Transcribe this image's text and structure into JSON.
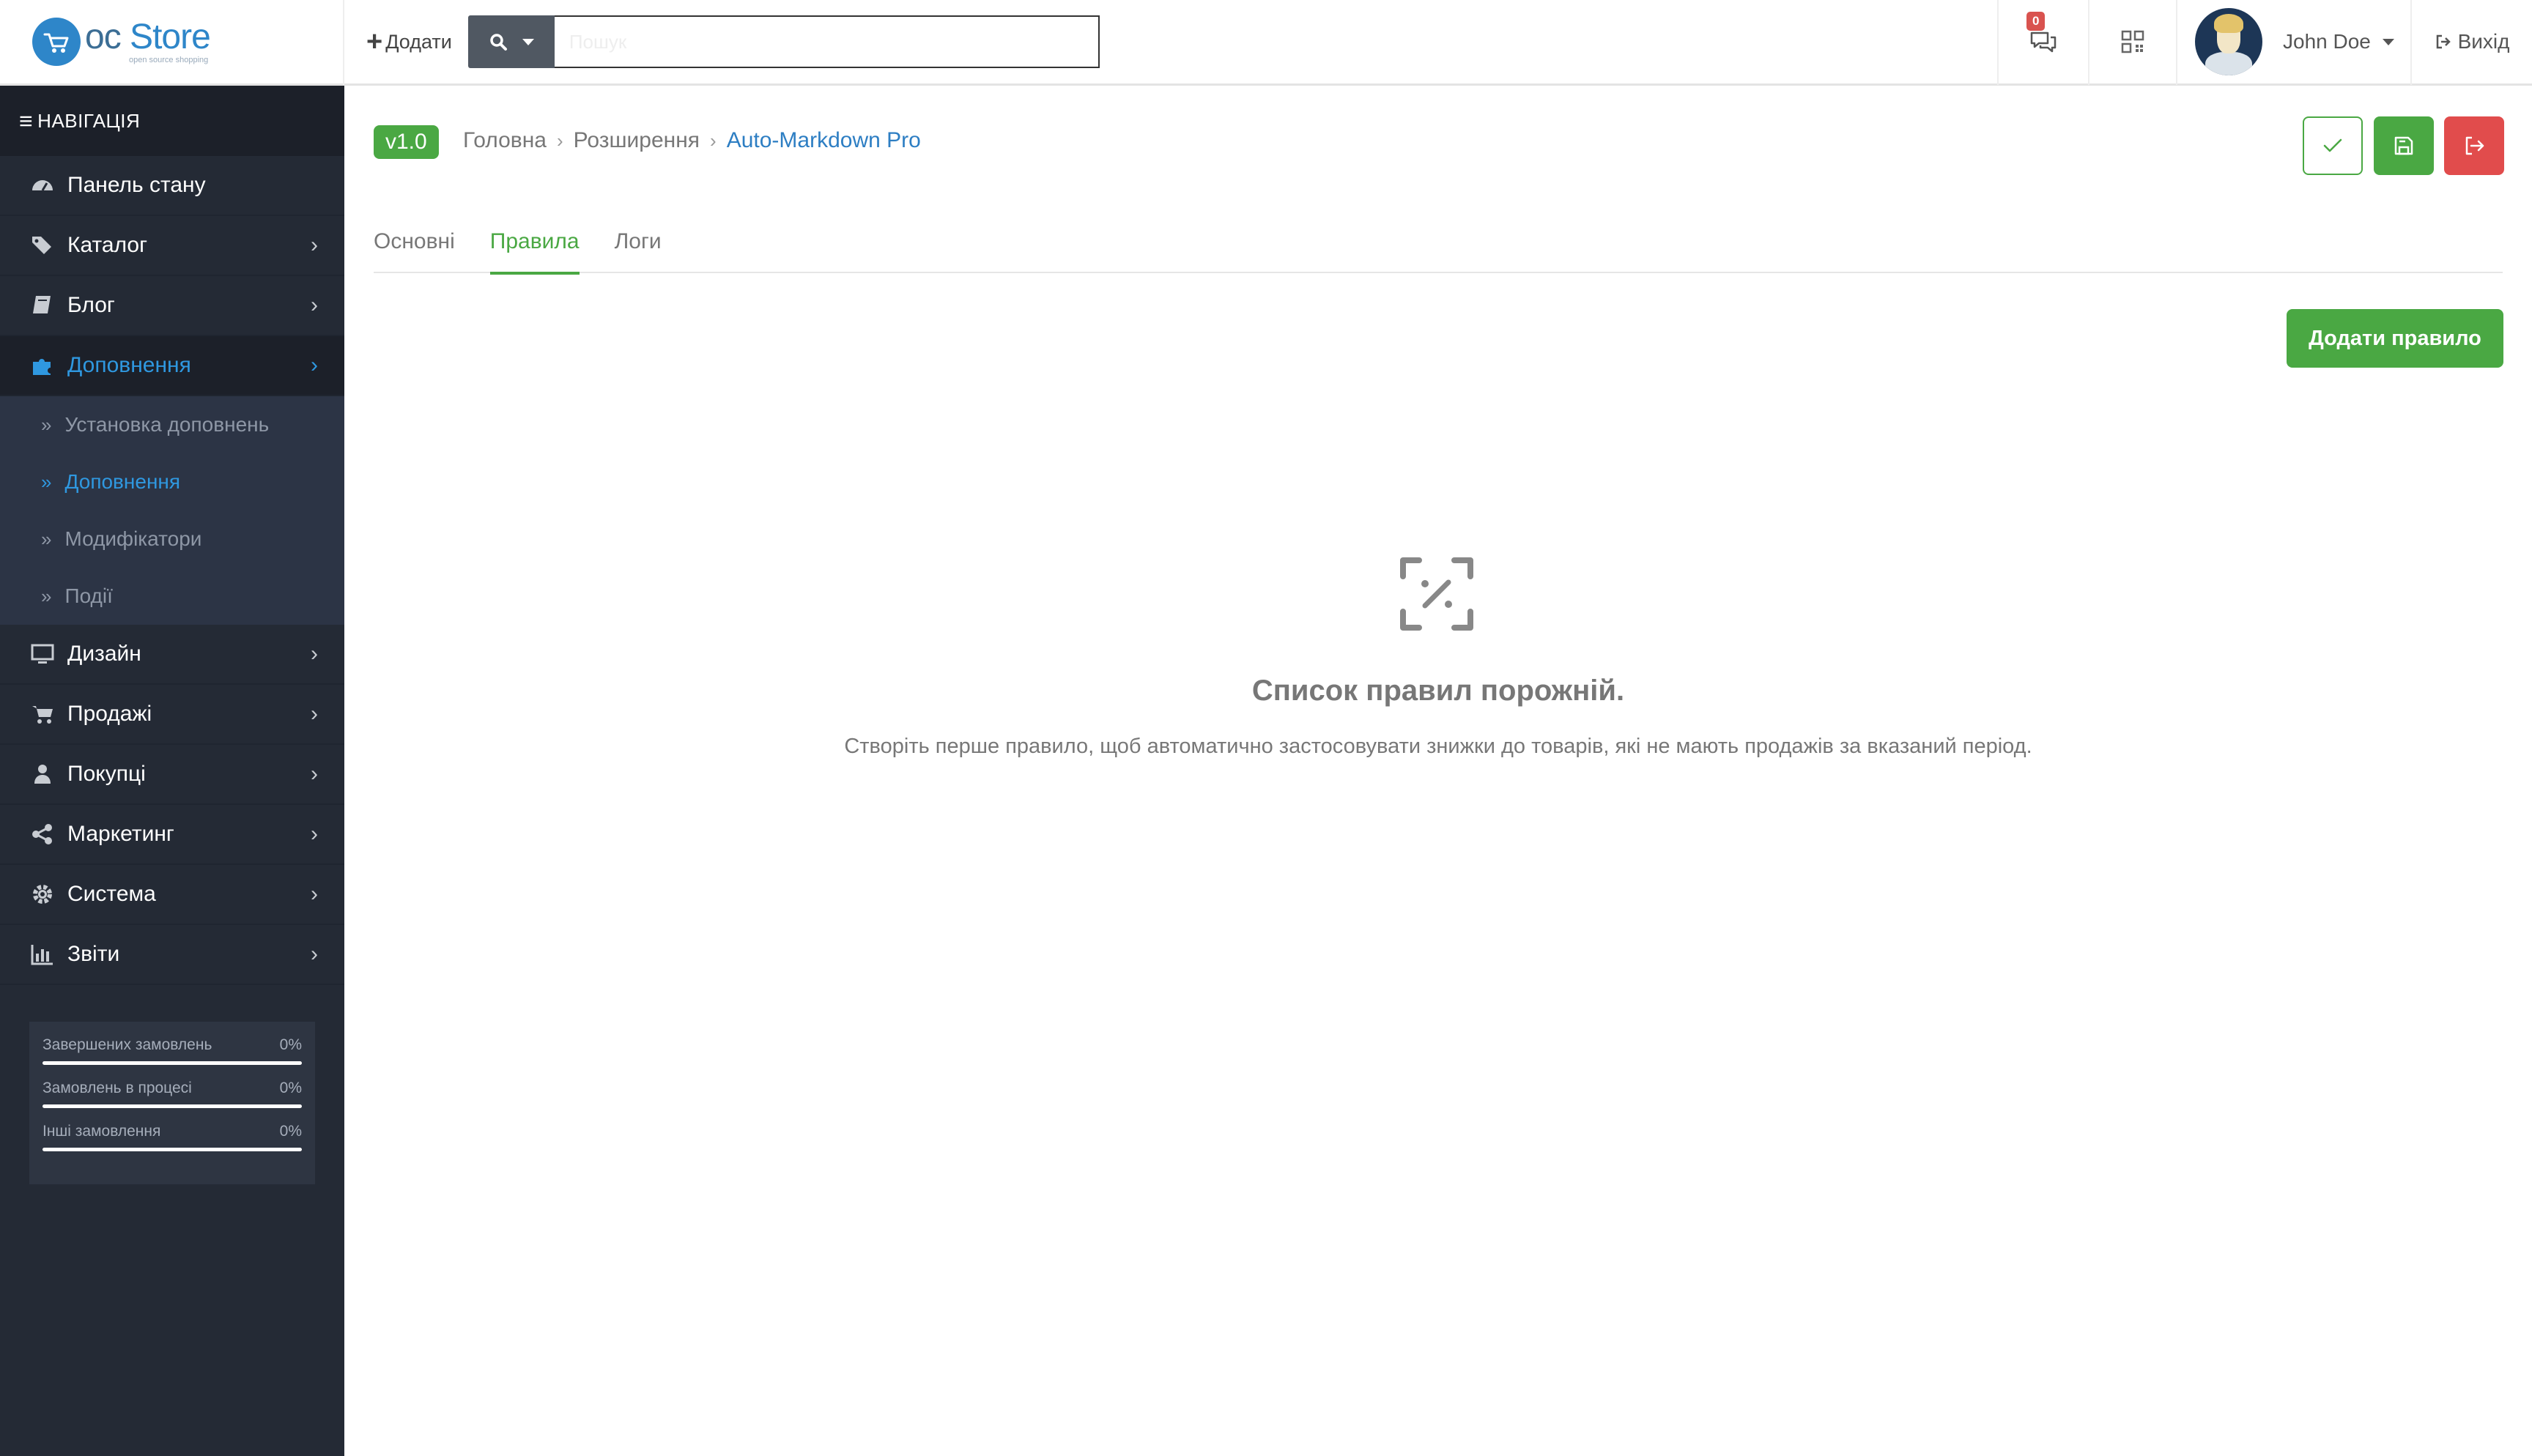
{
  "header": {
    "logo_prefix": "oc",
    "logo_brand": "Store",
    "logo_tagline": "open source shopping",
    "add_label": "Додати",
    "search_placeholder": "Пошук",
    "chat_badge": "0",
    "user_name": "John Doe",
    "logout_label": "Вихід"
  },
  "sidebar": {
    "title": "НАВІГАЦІЯ",
    "items": [
      {
        "label": "Панель стану",
        "icon": "dashboard-icon"
      },
      {
        "label": "Каталог",
        "icon": "tags-icon"
      },
      {
        "label": "Блог",
        "icon": "book-icon"
      },
      {
        "label": "Доповнення",
        "icon": "puzzle-icon"
      },
      {
        "label": "Дизайн",
        "icon": "monitor-icon"
      },
      {
        "label": "Продажі",
        "icon": "cart-icon"
      },
      {
        "label": "Покупці",
        "icon": "user-icon"
      },
      {
        "label": "Маркетинг",
        "icon": "share-icon"
      },
      {
        "label": "Система",
        "icon": "gear-icon"
      },
      {
        "label": "Звіти",
        "icon": "bar-chart-icon"
      }
    ],
    "subitems": [
      {
        "label": "Установка доповнень"
      },
      {
        "label": "Доповнення"
      },
      {
        "label": "Модифікатори"
      },
      {
        "label": "Події"
      }
    ],
    "stats": [
      {
        "label": "Завершених замовлень",
        "value": "0%",
        "progress": 0
      },
      {
        "label": "Замовлень в процесі",
        "value": "0%",
        "progress": 0
      },
      {
        "label": "Інші замовлення",
        "value": "0%",
        "progress": 0
      }
    ]
  },
  "main": {
    "version": "v1.0",
    "breadcrumb": [
      "Головна",
      "Розширення",
      "Auto-Markdown Pro"
    ],
    "tabs": [
      "Основні",
      "Правила",
      "Логи"
    ],
    "add_rule_label": "Додати правило",
    "empty_title": "Список правил порожній.",
    "empty_desc": "Створіть перше правило, щоб автоматично застосовувати знижки до товарів, які не мають продажів за вказаний період."
  },
  "colors": {
    "accent_green": "#4aa843",
    "danger_red": "#e14c4c",
    "link_blue": "#2d7ec3",
    "sidebar_bg": "#242a35"
  }
}
